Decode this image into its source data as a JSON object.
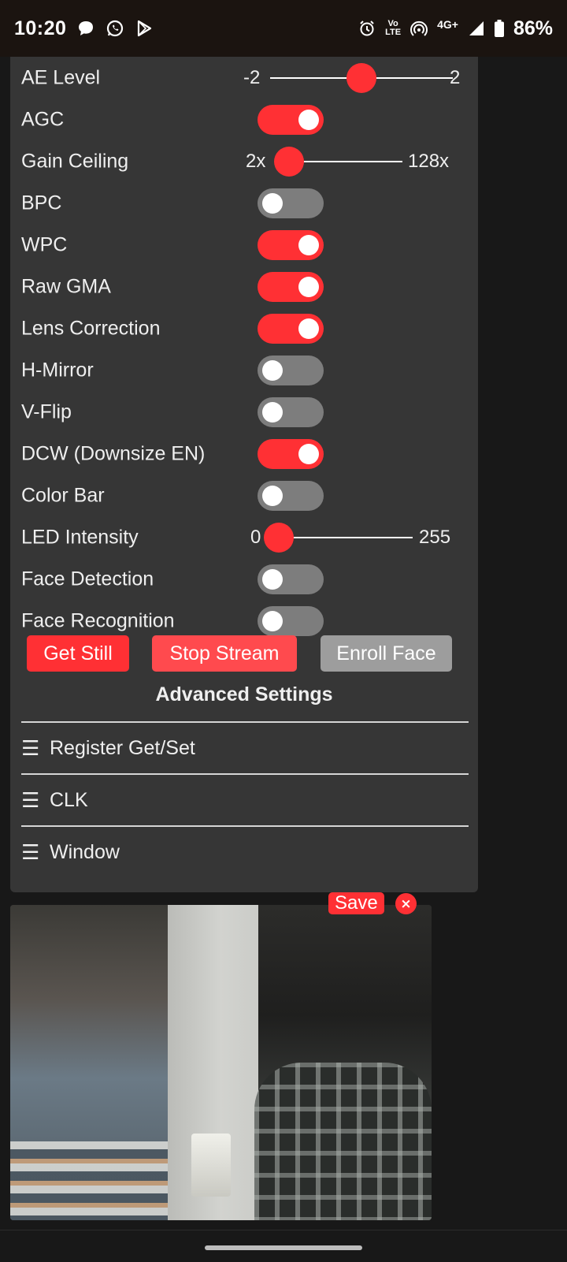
{
  "status_bar": {
    "time": "10:20",
    "left_icons": [
      "chat-bubble-icon",
      "whatsapp-icon",
      "play-store-icon"
    ],
    "right_icons": [
      "alarm-icon",
      "volte-icon",
      "hotspot-icon",
      "signal-icon",
      "battery-icon"
    ],
    "volte_line1": "Vo",
    "volte_line2": "LTE",
    "network": "4G+",
    "battery": "86%"
  },
  "colors": {
    "accent": "#ff3034",
    "panel": "#363636",
    "toggle_off": "#7d7d7d",
    "button_grey": "#9d9d9d"
  },
  "settings": {
    "ae_level": {
      "label": "AE Level",
      "min": "-2",
      "max": "2",
      "value": 0.5
    },
    "agc": {
      "label": "AGC",
      "on": true
    },
    "gain_ceiling": {
      "label": "Gain Ceiling",
      "min": "2x",
      "max": "128x",
      "value": 0
    },
    "bpc": {
      "label": "BPC",
      "on": false
    },
    "wpc": {
      "label": "WPC",
      "on": true
    },
    "raw_gma": {
      "label": "Raw GMA",
      "on": true
    },
    "lens_correction": {
      "label": "Lens Correction",
      "on": true
    },
    "h_mirror": {
      "label": "H-Mirror",
      "on": false
    },
    "v_flip": {
      "label": "V-Flip",
      "on": false
    },
    "dcw": {
      "label": "DCW (Downsize EN)",
      "on": true
    },
    "color_bar": {
      "label": "Color Bar",
      "on": false
    },
    "led_intensity": {
      "label": "LED Intensity",
      "min": "0",
      "max": "255",
      "value": 0
    },
    "face_detection": {
      "label": "Face Detection",
      "on": false
    },
    "face_recognition": {
      "label": "Face Recognition",
      "on": false
    }
  },
  "buttons": {
    "get_still": "Get Still",
    "stop_stream": "Stop Stream",
    "enroll_face": "Enroll Face"
  },
  "advanced": {
    "title": "Advanced Settings",
    "items": [
      {
        "icon": "☰",
        "label": "Register Get/Set"
      },
      {
        "icon": "☰",
        "label": "CLK"
      },
      {
        "icon": "☰",
        "label": "Window"
      }
    ]
  },
  "stream": {
    "save_label": "Save",
    "close_label": "×"
  }
}
